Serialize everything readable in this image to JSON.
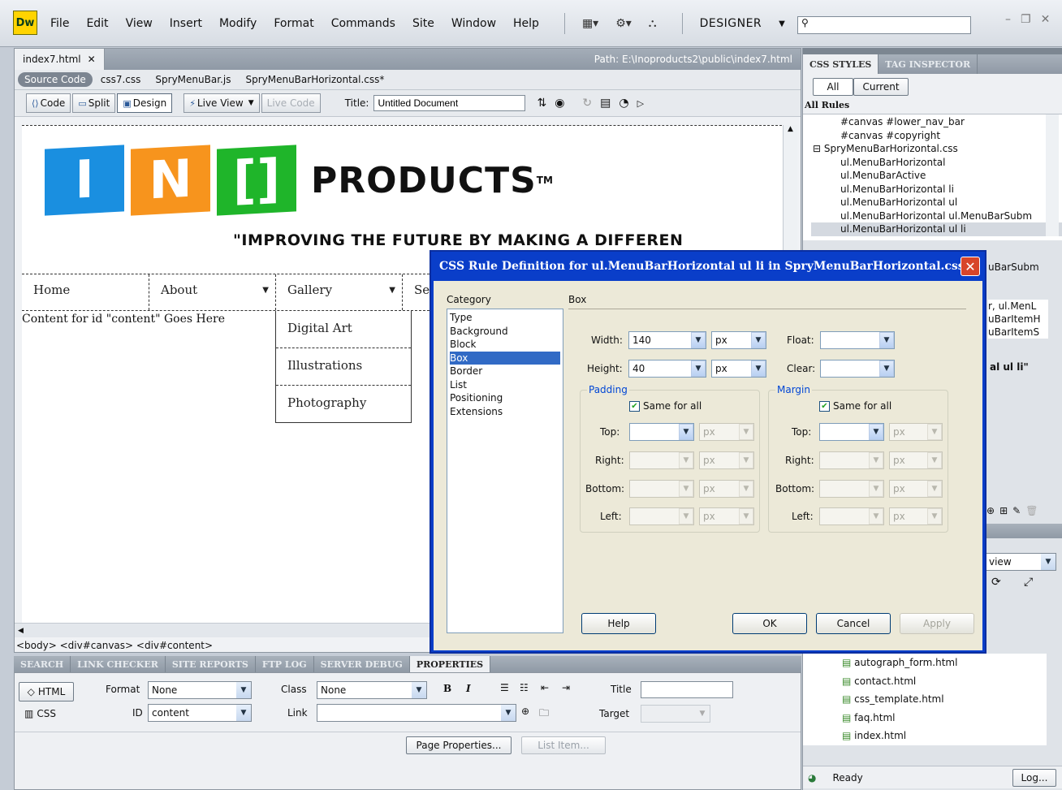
{
  "app": {
    "logo": "Dw",
    "menu": [
      "File",
      "Edit",
      "View",
      "Insert",
      "Modify",
      "Format",
      "Commands",
      "Site",
      "Window",
      "Help"
    ],
    "workspace": "DESIGNER",
    "search_value": ""
  },
  "document": {
    "tab": "index7.html",
    "path": "Path: E:\\Inoproducts2\\public\\index7.html",
    "related_files": [
      "Source Code",
      "css7.css",
      "SpryMenuBar.js",
      "SpryMenuBarHorizontal.css*"
    ],
    "view_buttons": {
      "code": "Code",
      "split": "Split",
      "design": "Design",
      "live_view": "Live View",
      "live_code": "Live Code"
    },
    "title_label": "Title:",
    "title_value": "Untitled Document"
  },
  "page": {
    "logo_letters": [
      "I",
      "N",
      "[]"
    ],
    "brand": "PRODUCTS",
    "tm": "TM",
    "slogan": "\"IMPROVING THE FUTURE BY MAKING A DIFFEREN",
    "nav": [
      "Home",
      "About",
      "Gallery",
      "Se"
    ],
    "content": "Content for id \"content\" Goes Here",
    "dropdown": [
      "Digital Art",
      "Illustrations",
      "Photography"
    ]
  },
  "tag_selector": "<body> <div#canvas> <div#content>",
  "panels": {
    "tabs": [
      "SEARCH",
      "LINK CHECKER",
      "SITE REPORTS",
      "FTP LOG",
      "SERVER DEBUG",
      "PROPERTIES"
    ]
  },
  "properties": {
    "html_btn": "HTML",
    "css_btn": "CSS",
    "format_label": "Format",
    "format_value": "None",
    "class_label": "Class",
    "class_value": "None",
    "id_label": "ID",
    "id_value": "content",
    "link_label": "Link",
    "link_value": "",
    "title_label": "Title",
    "target_label": "Target",
    "bold": "B",
    "italic": "I",
    "page_props": "Page Properties...",
    "list_item": "List Item..."
  },
  "css_panel": {
    "tabs": [
      "CSS STYLES",
      "TAG INSPECTOR"
    ],
    "mode_all": "All",
    "mode_current": "Current",
    "rules_label": "All Rules",
    "rules": [
      "#canvas #lower_nav_bar",
      "#canvas #copyright",
      "SpryMenuBarHorizontal.css",
      "ul.MenuBarHorizontal",
      "ul.MenuBarActive",
      "ul.MenuBarHorizontal li",
      "ul.MenuBarHorizontal ul",
      "ul.MenuBarHorizontal ul.MenuBarSubm",
      "ul.MenuBarHorizontal ul li"
    ],
    "peek": [
      "uBarSubm",
      "r, ul.MenL",
      "uBarItemH",
      "uBarItemS",
      "al ul li\""
    ],
    "files_view": "view",
    "files": [
      "autograph_form.html",
      "contact.html",
      "css_template.html",
      "faq.html",
      "index.html"
    ],
    "status": "Ready",
    "log": "Log..."
  },
  "dialog": {
    "title": "CSS Rule Definition for ul.MenuBarHorizontal ul li in SpryMenuBarHorizontal.css",
    "category_label": "Category",
    "section": "Box",
    "categories": [
      "Type",
      "Background",
      "Block",
      "Box",
      "Border",
      "List",
      "Positioning",
      "Extensions"
    ],
    "selected_category": "Box",
    "width_label": "Width:",
    "width_value": "140",
    "width_unit": "px",
    "height_label": "Height:",
    "height_value": "40",
    "height_unit": "px",
    "float_label": "Float:",
    "clear_label": "Clear:",
    "padding_label": "Padding",
    "margin_label": "Margin",
    "same_for_all": "Same for all",
    "sides": [
      "Top:",
      "Right:",
      "Bottom:",
      "Left:"
    ],
    "unit_placeholder": "px",
    "buttons": {
      "help": "Help",
      "ok": "OK",
      "cancel": "Cancel",
      "apply": "Apply"
    }
  },
  "colors": {
    "logo_blue": "#1a8fe0",
    "logo_orange": "#f7941d",
    "logo_green": "#1fb52a",
    "dialog_title": "#0a3ec9",
    "selection": "#316ac5"
  }
}
